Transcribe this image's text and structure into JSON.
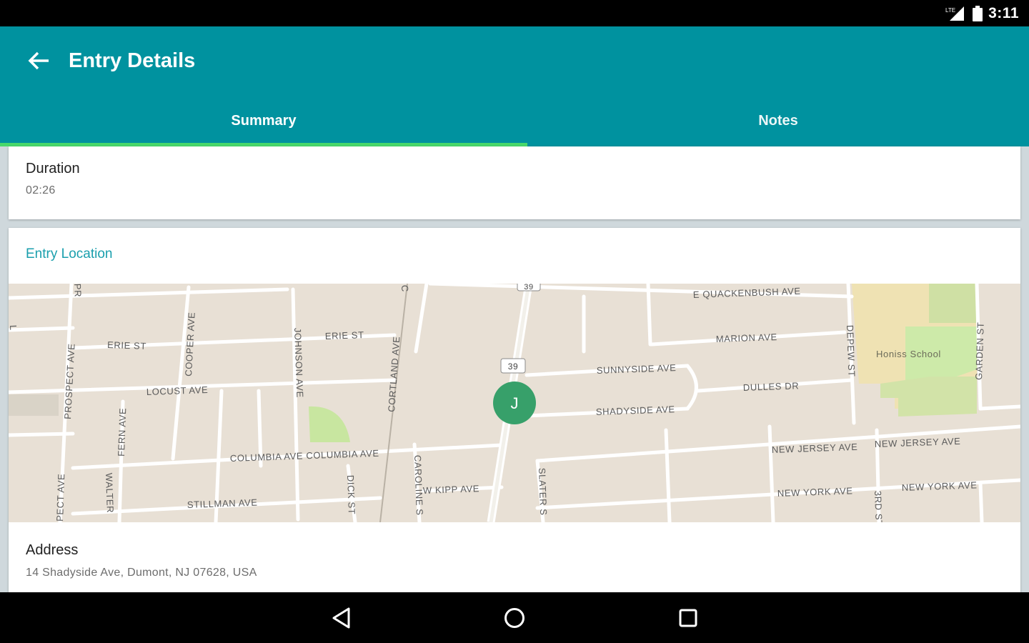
{
  "status_bar": {
    "time": "3:11",
    "icons": [
      "signal-icon",
      "battery-icon"
    ]
  },
  "app_bar": {
    "title": "Entry Details",
    "back_icon": "arrow-back-icon"
  },
  "tabs": [
    {
      "label": "Summary",
      "selected": true
    },
    {
      "label": "Notes",
      "selected": false
    }
  ],
  "duration": {
    "label": "Duration",
    "value": "02:26"
  },
  "location": {
    "section_title": "Entry Location",
    "marker_label": "J",
    "address_label": "Address",
    "address_value": "14 Shadyside Ave, Dumont, NJ 07628, USA"
  },
  "map": {
    "route_badge_top": "39",
    "route_badge": "39",
    "school_label": "Honiss School",
    "street_labels": {
      "quackenbush": "E QUACKENBUSH AVE",
      "marion": "MARION AVE",
      "sunnyside": "SUNNYSIDE AVE",
      "shadyside": "SHADYSIDE AVE",
      "dulles": "DULLES DR",
      "erie_west": "ERIE ST",
      "erie_east": "ERIE ST",
      "locust": "LOCUST AVE",
      "columbia": "COLUMBIA AVE COLUMBIA AVE",
      "stillman": "STILLMAN AVE",
      "w_kipp": "W KIPP AVE",
      "new_jersey_1": "NEW JERSEY AVE",
      "new_jersey_2": "NEW JERSEY AVE",
      "new_york_1": "NEW YORK AVE",
      "new_york_2": "NEW YORK AVE",
      "prospect_top": "PROSPECT AVE",
      "prospect_bottom": "PECT AVE",
      "cooper": "COOPER AVE",
      "johnson": "JOHNSON AVE",
      "cortland": "CORTLAND AVE",
      "fern": "FERN AVE",
      "walter": "WALTER",
      "dick": "DICK ST",
      "caroline": "CAROLINE S",
      "slater": "SLATER S",
      "depew": "DEPEW ST",
      "garden": "GARDEN ST",
      "third": "3RD ST",
      "pr": "PR",
      "c": "C",
      "l": "L"
    }
  },
  "nav_bar": {
    "icons": [
      "back-triangle-icon",
      "home-circle-icon",
      "recents-square-icon"
    ]
  },
  "colors": {
    "primary": "#00929f",
    "indicator": "#48d86b",
    "accent_text": "#1a9fad",
    "marker": "#37a06a"
  }
}
